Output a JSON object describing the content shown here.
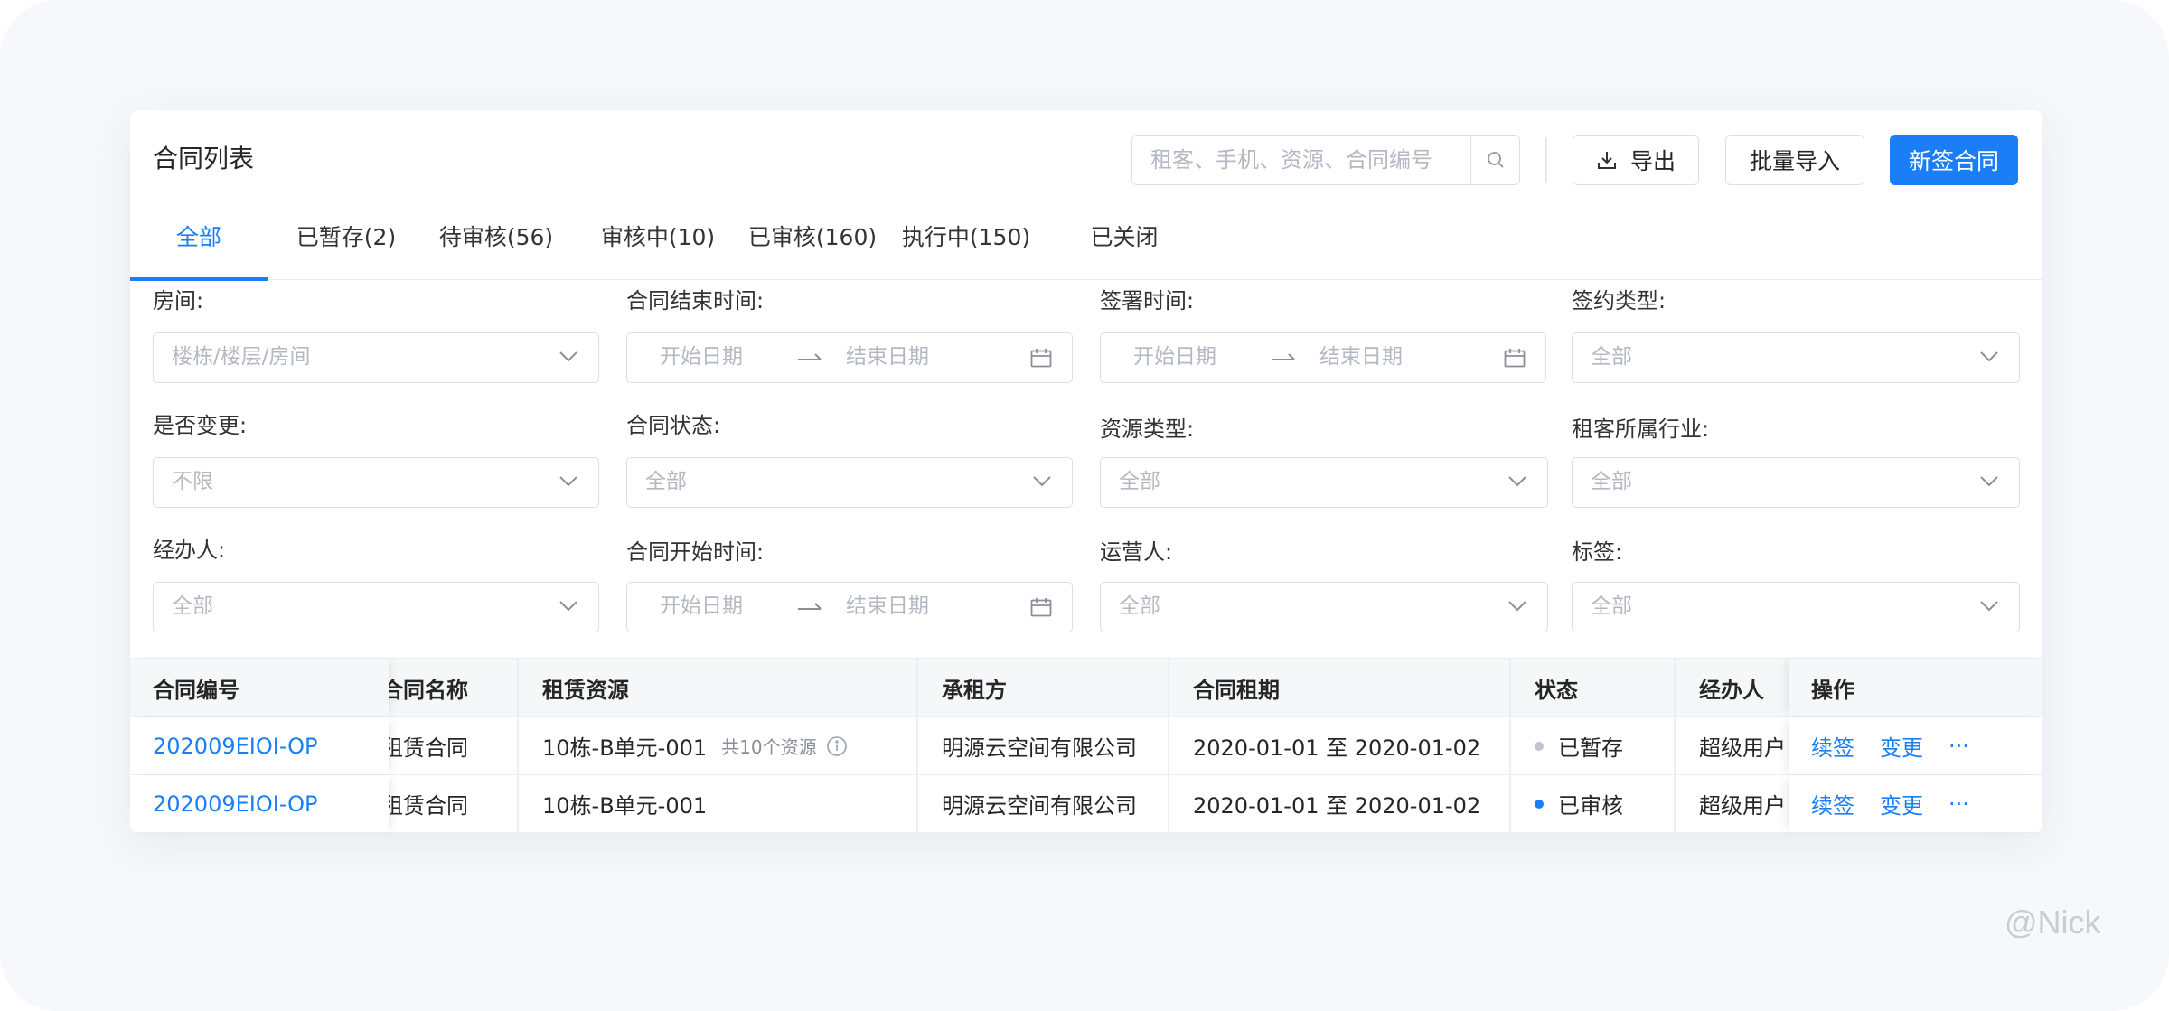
{
  "header": {
    "title": "合同列表",
    "search_placeholder": "租客、手机、资源、合同编号",
    "export_label": "导出",
    "import_label": "批量导入",
    "new_label": "新签合同"
  },
  "tabs": [
    {
      "label": "全部",
      "active": true
    },
    {
      "label": "已暂存(2)"
    },
    {
      "label": "待审核(56)"
    },
    {
      "label": "审核中(10)"
    },
    {
      "label": "已审核(160)"
    },
    {
      "label": "执行中(150)"
    },
    {
      "label": "已关闭"
    }
  ],
  "filters": {
    "room": {
      "label": "房间:",
      "placeholder": "楼栋/楼层/房间"
    },
    "end_time": {
      "label": "合同结束时间:",
      "start": "开始日期",
      "end": "结束日期"
    },
    "sign_time": {
      "label": "签署时间:",
      "start": "开始日期",
      "end": "结束日期"
    },
    "sign_type": {
      "label": "签约类型:",
      "placeholder": "全部"
    },
    "changed": {
      "label": "是否变更:",
      "placeholder": "不限"
    },
    "status": {
      "label": "合同状态:",
      "placeholder": "全部"
    },
    "resource_type": {
      "label": "资源类型:",
      "placeholder": "全部"
    },
    "industry": {
      "label": "租客所属行业:",
      "placeholder": "全部"
    },
    "handler": {
      "label": "经办人:",
      "placeholder": "全部"
    },
    "start_time": {
      "label": "合同开始时间:",
      "start": "开始日期",
      "end": "结束日期"
    },
    "operator": {
      "label": "运营人:",
      "placeholder": "全部"
    },
    "tag": {
      "label": "标签:",
      "placeholder": "全部"
    }
  },
  "table": {
    "columns": {
      "code": "合同编号",
      "name": "合同名称",
      "resource": "租赁资源",
      "tenant": "承租方",
      "period": "合同租期",
      "status": "状态",
      "handler": "经办人",
      "ops": "操作"
    },
    "rows": [
      {
        "code": "202009EIOI-OP",
        "name": "租赁合同",
        "resource": "10栋-B单元-001",
        "resource_extra": "共10个资源",
        "tenant": "明源云空间有限公司",
        "period": "2020-01-01 至 2020-01-02",
        "status": "已暂存",
        "status_color": "#c0c4cc",
        "handler": "超级用户",
        "op_renew": "续签",
        "op_change": "变更",
        "op_more": "···"
      },
      {
        "code": "202009EIOI-OP",
        "name": "租赁合同",
        "resource": "10栋-B单元-001",
        "resource_extra": "",
        "tenant": "明源云空间有限公司",
        "period": "2020-01-01 至 2020-01-02",
        "status": "已审核",
        "status_color": "#1a7ef6",
        "handler": "超级用户",
        "op_renew": "续签",
        "op_change": "变更",
        "op_more": "···"
      }
    ]
  },
  "watermark": "@Nick",
  "colors": {
    "accent": "#1a7ef6",
    "border": "#dcdfe6",
    "placeholder": "#b3b8c2"
  }
}
